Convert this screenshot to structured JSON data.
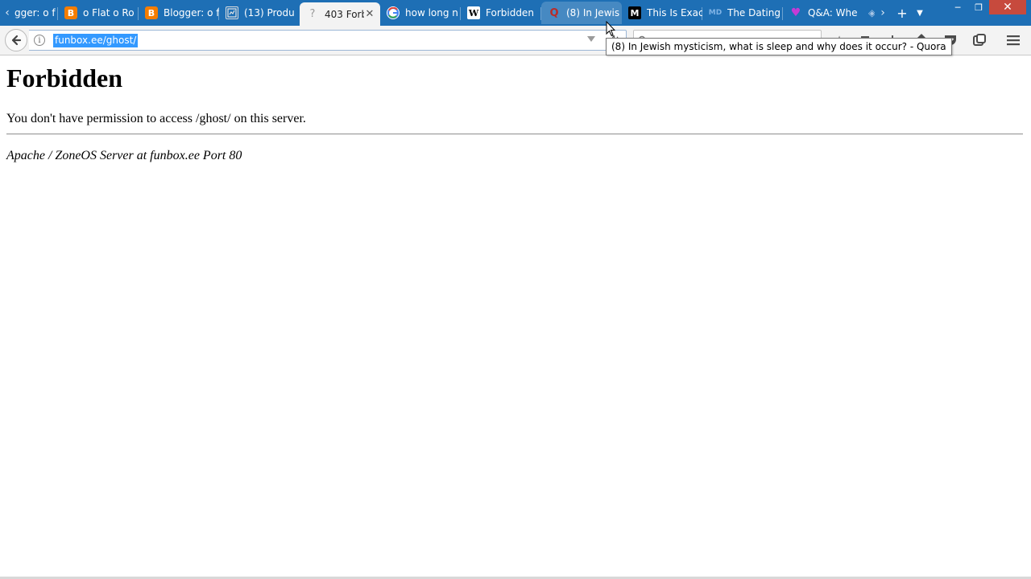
{
  "browser": {
    "tabs": [
      {
        "label": "gger: o f",
        "icon": "blogger-icon"
      },
      {
        "label": "o Flat o Ro",
        "icon": "blogger-icon"
      },
      {
        "label": "Blogger: o f",
        "icon": "blogger-icon"
      },
      {
        "label": "(13) Produ",
        "icon": "page-icon"
      },
      {
        "label": "403 Forb",
        "icon": "question-icon",
        "active": true
      },
      {
        "label": "how long n",
        "icon": "google-icon"
      },
      {
        "label": "Forbidden",
        "icon": "wikipedia-icon"
      },
      {
        "label": "(8) In Jewis",
        "icon": "quora-icon"
      },
      {
        "label": "This Is Exac",
        "icon": "medium-icon"
      },
      {
        "label": "The Dating",
        "icon": "webmd-icon"
      },
      {
        "label": "Q&A: Whe",
        "icon": "heart-icon"
      }
    ],
    "url": "funbox.ee/ghost/",
    "tooltip": "(8) In Jewish mysticism, what is sleep and why does it occur? - Quora",
    "colors": {
      "tabstrip": "#1e6fb5",
      "toolbar": "#f3f3f3",
      "selection": "#3399ff",
      "close_button": "#c74a3d"
    }
  },
  "page": {
    "heading": "Forbidden",
    "message": "You don't have permission to access /ghost/ on this server.",
    "address": "Apache / ZoneOS Server at funbox.ee Port 80"
  }
}
